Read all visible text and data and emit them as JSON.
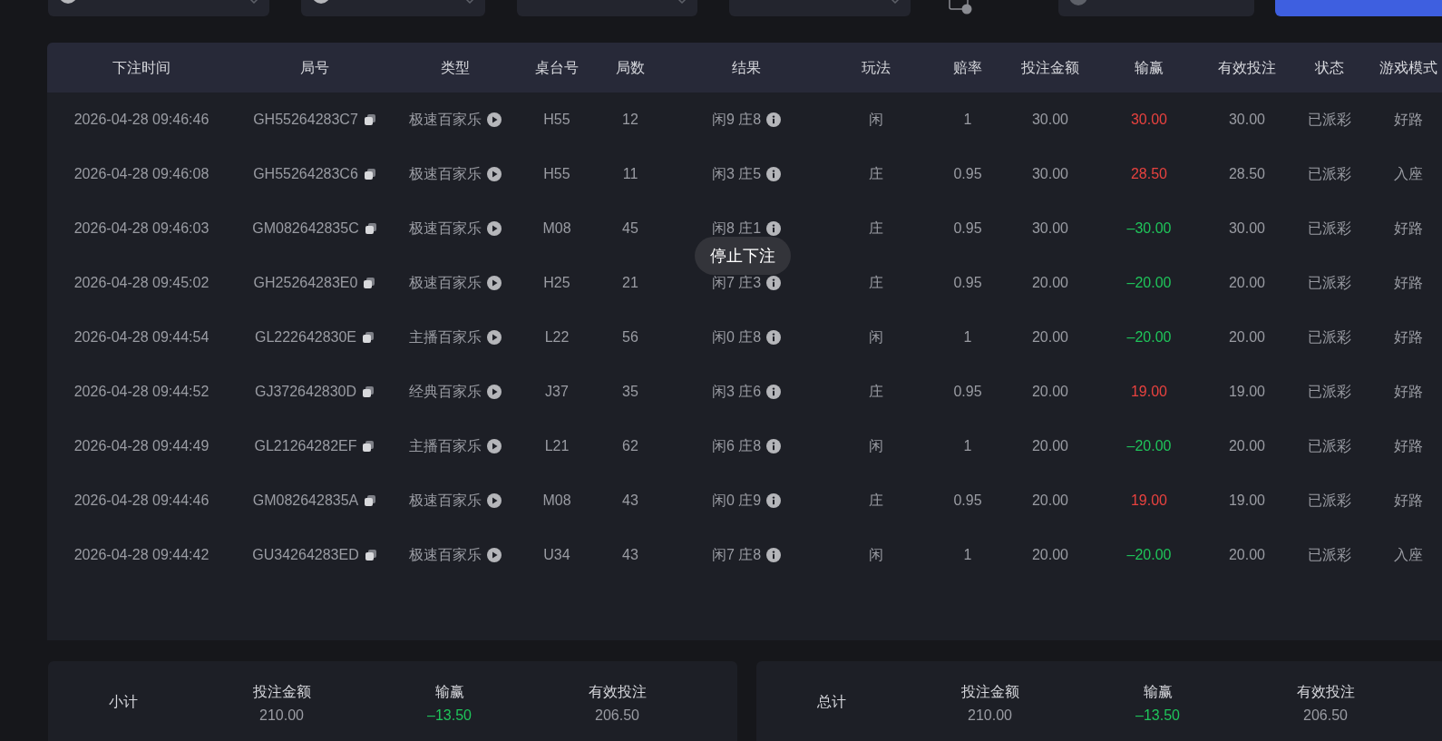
{
  "table": {
    "columns": [
      "下注时间",
      "局号",
      "类型",
      "桌台号",
      "局数",
      "结果",
      "玩法",
      "赔率",
      "投注金额",
      "输赢",
      "有效投注",
      "状态",
      "游戏模式"
    ],
    "rows": [
      {
        "time": "2026-04-28 09:46:46",
        "round_id": "GH55264283C7",
        "type": "极速百家乐",
        "table_no": "H55",
        "round_no": "12",
        "result": "闲9 庄8",
        "bet": "闲",
        "odds": "1",
        "amount": "30.00",
        "win_loss": {
          "text": "30.00",
          "kind": "win"
        },
        "valid_bet": "30.00",
        "status": "已派彩",
        "mode": "好路"
      },
      {
        "time": "2026-04-28 09:46:08",
        "round_id": "GH55264283C6",
        "type": "极速百家乐",
        "table_no": "H55",
        "round_no": "11",
        "result": "闲3 庄5",
        "bet": "庄",
        "odds": "0.95",
        "amount": "30.00",
        "win_loss": {
          "text": "28.50",
          "kind": "win"
        },
        "valid_bet": "28.50",
        "status": "已派彩",
        "mode": "入座"
      },
      {
        "time": "2026-04-28 09:46:03",
        "round_id": "GM082642835C",
        "type": "极速百家乐",
        "table_no": "M08",
        "round_no": "45",
        "result": "闲8 庄1",
        "bet": "庄",
        "odds": "0.95",
        "amount": "30.00",
        "win_loss": {
          "text": "–30.00",
          "kind": "loss"
        },
        "valid_bet": "30.00",
        "status": "已派彩",
        "mode": "好路"
      },
      {
        "time": "2026-04-28 09:45:02",
        "round_id": "GH25264283E0",
        "type": "极速百家乐",
        "table_no": "H25",
        "round_no": "21",
        "result": "闲7 庄3",
        "bet": "庄",
        "odds": "0.95",
        "amount": "20.00",
        "win_loss": {
          "text": "–20.00",
          "kind": "loss"
        },
        "valid_bet": "20.00",
        "status": "已派彩",
        "mode": "好路"
      },
      {
        "time": "2026-04-28 09:44:54",
        "round_id": "GL222642830E",
        "type": "主播百家乐",
        "table_no": "L22",
        "round_no": "56",
        "result": "闲0 庄8",
        "bet": "闲",
        "odds": "1",
        "amount": "20.00",
        "win_loss": {
          "text": "–20.00",
          "kind": "loss"
        },
        "valid_bet": "20.00",
        "status": "已派彩",
        "mode": "好路"
      },
      {
        "time": "2026-04-28 09:44:52",
        "round_id": "GJ372642830D",
        "type": "经典百家乐",
        "table_no": "J37",
        "round_no": "35",
        "result": "闲3 庄6",
        "bet": "庄",
        "odds": "0.95",
        "amount": "20.00",
        "win_loss": {
          "text": "19.00",
          "kind": "win"
        },
        "valid_bet": "19.00",
        "status": "已派彩",
        "mode": "好路"
      },
      {
        "time": "2026-04-28 09:44:49",
        "round_id": "GL21264282EF",
        "type": "主播百家乐",
        "table_no": "L21",
        "round_no": "62",
        "result": "闲6 庄8",
        "bet": "闲",
        "odds": "1",
        "amount": "20.00",
        "win_loss": {
          "text": "–20.00",
          "kind": "loss"
        },
        "valid_bet": "20.00",
        "status": "已派彩",
        "mode": "好路"
      },
      {
        "time": "2026-04-28 09:44:46",
        "round_id": "GM082642835A",
        "type": "极速百家乐",
        "table_no": "M08",
        "round_no": "43",
        "result": "闲0 庄9",
        "bet": "庄",
        "odds": "0.95",
        "amount": "20.00",
        "win_loss": {
          "text": "19.00",
          "kind": "win"
        },
        "valid_bet": "19.00",
        "status": "已派彩",
        "mode": "好路"
      },
      {
        "time": "2026-04-28 09:44:42",
        "round_id": "GU34264283ED",
        "type": "极速百家乐",
        "table_no": "U34",
        "round_no": "43",
        "result": "闲7 庄8",
        "bet": "闲",
        "odds": "1",
        "amount": "20.00",
        "win_loss": {
          "text": "–20.00",
          "kind": "loss"
        },
        "valid_bet": "20.00",
        "status": "已派彩",
        "mode": "入座"
      }
    ]
  },
  "toast": "停止下注",
  "summaries": [
    {
      "title": "小计",
      "items": [
        {
          "label": "投注金额",
          "value": "210.00",
          "kind": "plain"
        },
        {
          "label": "输赢",
          "value": "–13.50",
          "kind": "loss"
        },
        {
          "label": "有效投注",
          "value": "206.50",
          "kind": "plain"
        }
      ]
    },
    {
      "title": "总计",
      "items": [
        {
          "label": "投注金额",
          "value": "210.00",
          "kind": "plain"
        },
        {
          "label": "输赢",
          "value": "–13.50",
          "kind": "loss"
        },
        {
          "label": "有效投注",
          "value": "206.50",
          "kind": "plain"
        }
      ]
    }
  ]
}
